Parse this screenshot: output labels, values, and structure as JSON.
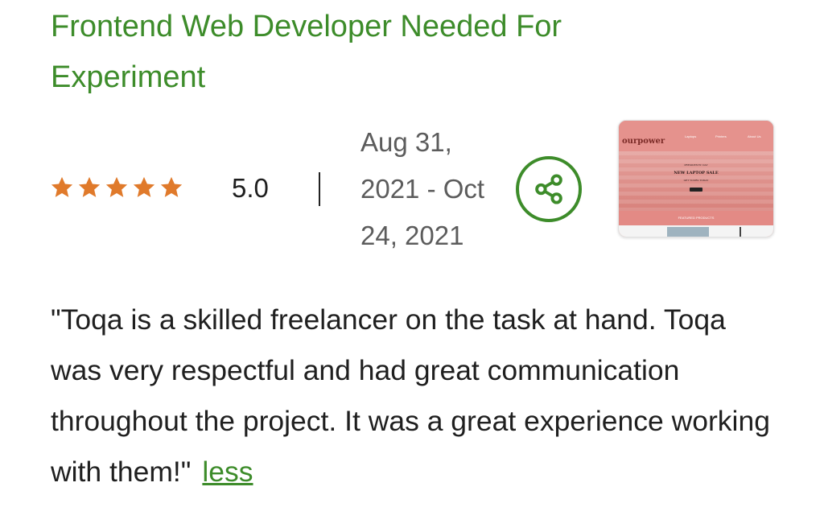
{
  "job": {
    "title": "Frontend Web Developer Needed For Experiment"
  },
  "rating": {
    "value": "5.0",
    "stars": 5,
    "star_color": "#e07a2b"
  },
  "dates": {
    "line1": "Aug 31,",
    "line2": "2021 - Oct",
    "line3": "24, 2021"
  },
  "share": {
    "icon": "share-icon",
    "color": "#3d8c2a"
  },
  "thumbnail": {
    "logo": "ourpower",
    "nav_links": [
      "Laptops",
      "Printers",
      "About Us"
    ],
    "hero_kicker": "PRESIDENTS' DAY",
    "hero_title": "NEW LAPTOP SALE",
    "hero_sub": "GET YOURS TODAY",
    "hero_button": "Shop now",
    "section_title": "FEATURED PRODUCTS"
  },
  "review": {
    "text": "\"Toqa is a skilled freelancer on the task at hand. Toqa was very respectful and had great communication throughout the project. It was a great experience working with them!\"",
    "toggle_label": "less"
  },
  "colors": {
    "accent_green": "#3d8c2a",
    "text_dark": "#1f1f1f",
    "text_muted": "#5c5c5c"
  }
}
